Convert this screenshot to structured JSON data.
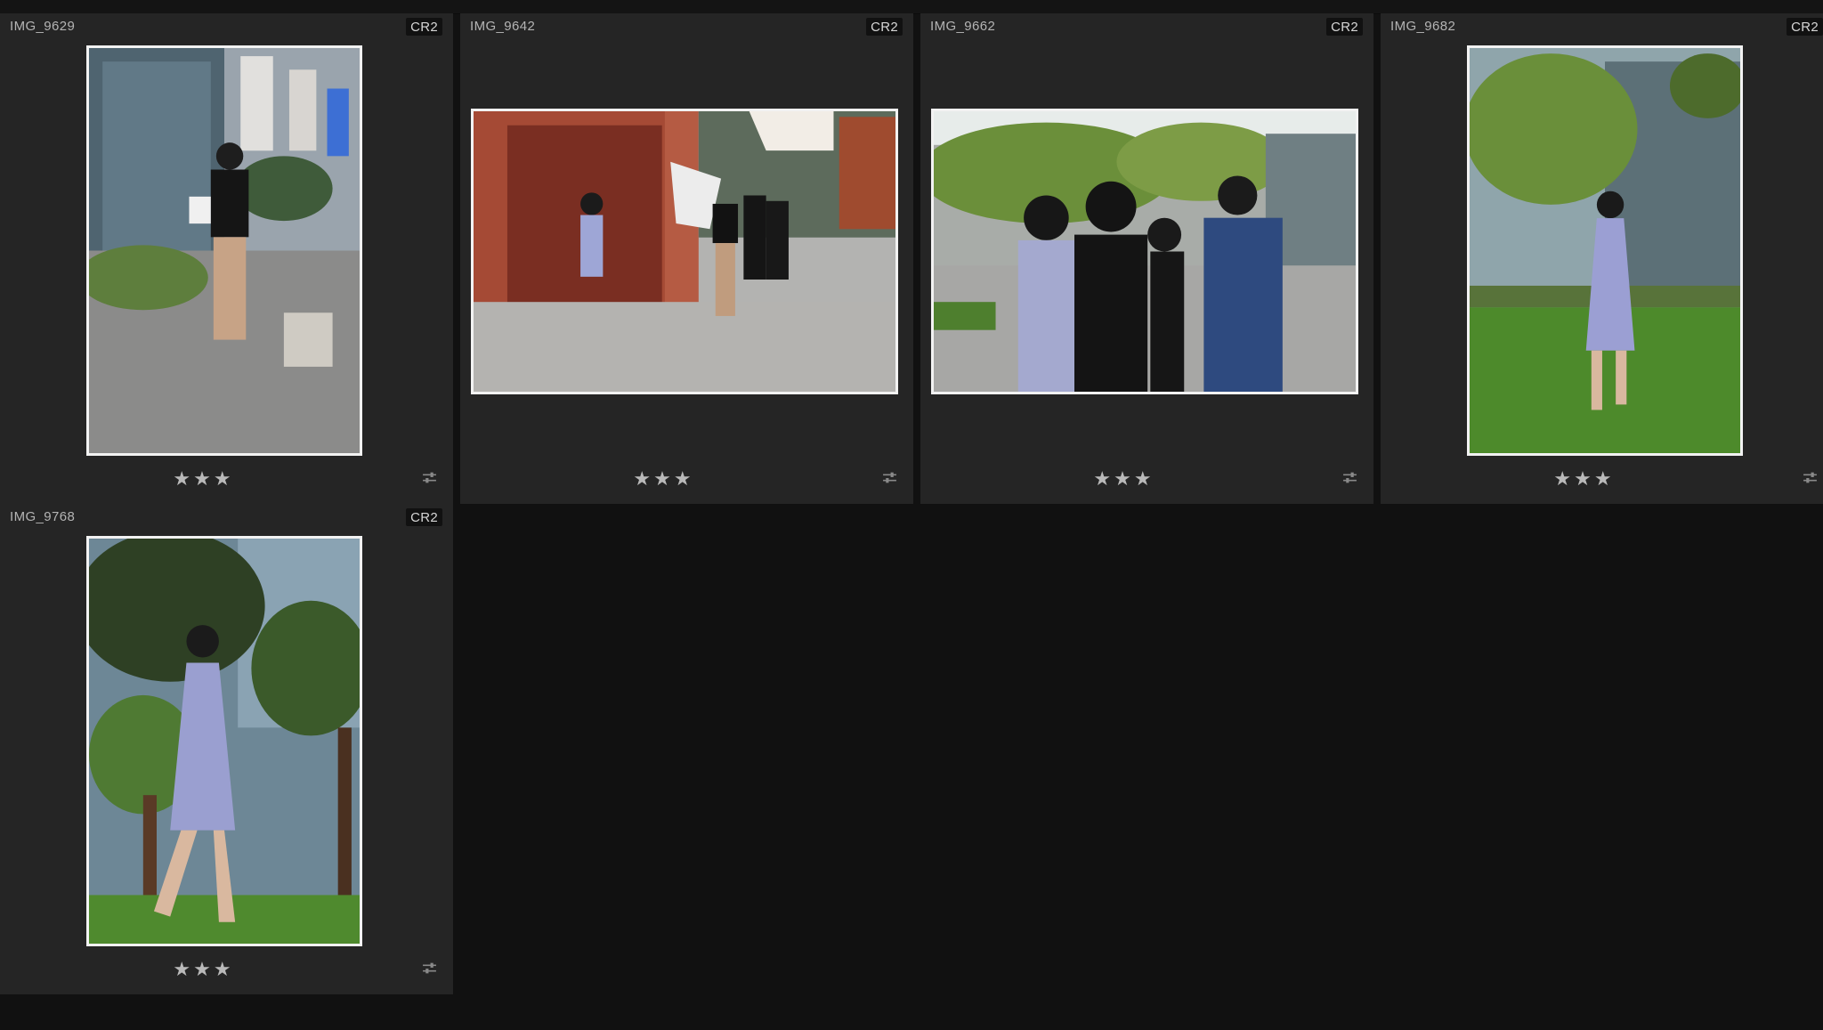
{
  "grid": {
    "cells": [
      {
        "filename": "IMG_9629",
        "badge": "CR2",
        "stars": "★★★",
        "orientation": "portrait"
      },
      {
        "filename": "IMG_9642",
        "badge": "CR2",
        "stars": "★★★",
        "orientation": "landscape"
      },
      {
        "filename": "IMG_9662",
        "badge": "CR2",
        "stars": "★★★",
        "orientation": "landscape"
      },
      {
        "filename": "IMG_9682",
        "badge": "CR2",
        "stars": "★★★",
        "orientation": "portrait"
      },
      {
        "filename": "IMG_9768",
        "badge": "CR2",
        "stars": "★★★",
        "orientation": "portrait"
      }
    ]
  },
  "colors": {
    "background": "#111111",
    "cell": "#252525",
    "thumbnail_border": "#f2f2f2",
    "text": "#b4b4b4"
  },
  "icons": {
    "rating": "star-icon",
    "develop_adjustments": "sliders-icon"
  }
}
